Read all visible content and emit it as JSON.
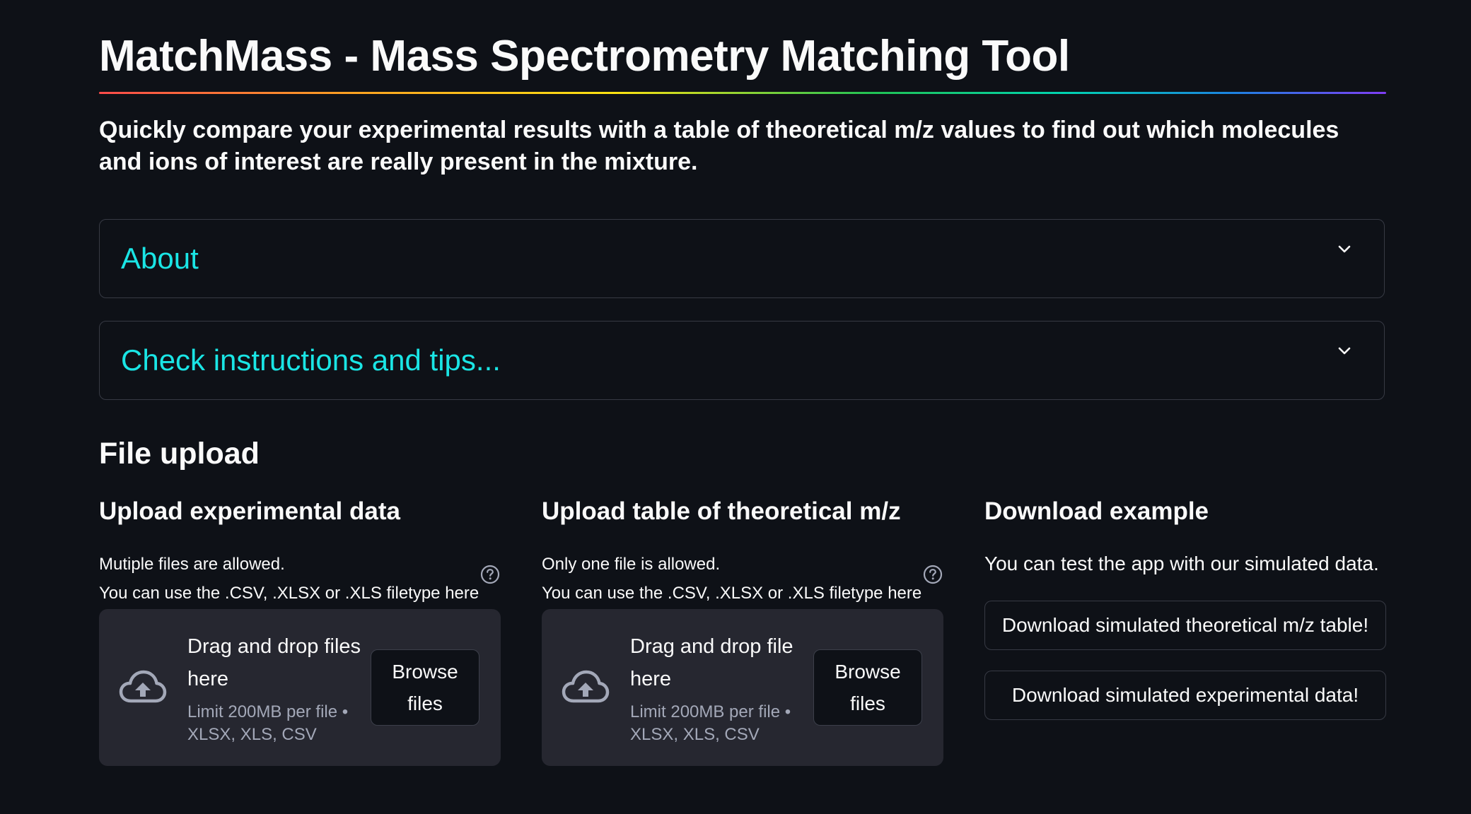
{
  "header": {
    "title": "MatchMass - Mass Spectrometry Matching Tool",
    "subtitle": "Quickly compare your experimental results with a table of theoretical m/z values to find out which molecules and ions of interest are really present in the mixture."
  },
  "expanders": [
    {
      "label": "About"
    },
    {
      "label": "Check instructions and tips..."
    }
  ],
  "file_upload": {
    "heading": "File upload",
    "experimental": {
      "heading": "Upload experimental data",
      "help_line1": "Mutiple files are allowed.",
      "help_line2": "You can use the .CSV, .XLSX or .XLS filetype here",
      "dropzone_title": "Drag and drop files here",
      "dropzone_limit": "Limit 200MB per file • XLSX, XLS, CSV",
      "browse_label": "Browse files"
    },
    "theoretical": {
      "heading": "Upload table of theoretical m/z",
      "help_line1": "Only one file is allowed.",
      "help_line2": "You can use the .CSV, .XLSX or .XLS filetype here",
      "dropzone_title": "Drag and drop file here",
      "dropzone_limit": "Limit 200MB per file • XLSX, XLS, CSV",
      "browse_label": "Browse files"
    },
    "download": {
      "heading": "Download example",
      "text": "You can test the app with our simulated data.",
      "button1": "Download simulated theoretical m/z table!",
      "button2": "Download simulated experimental data!"
    }
  },
  "colors": {
    "background": "#0e1117",
    "expander_label": "#1ae5e5",
    "dropzone": "#262730",
    "muted_text": "#a3a8b8"
  },
  "icons": [
    "chevron-down-icon",
    "help-circle-icon",
    "cloud-upload-icon"
  ]
}
